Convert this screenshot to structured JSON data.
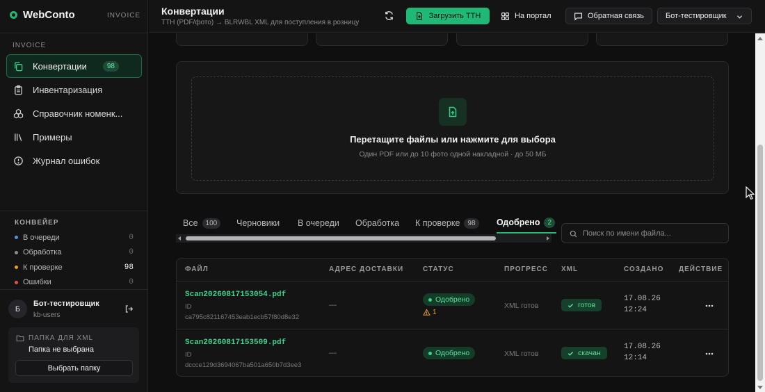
{
  "brand": {
    "name": "WebConto",
    "tag": "INVOICE"
  },
  "sidebar": {
    "section_label": "INVOICE",
    "nav": [
      {
        "label": "Конвертации",
        "badge": "98",
        "icon": "copy-icon",
        "active": true
      },
      {
        "label": "Инвентаризация",
        "icon": "clipboard-icon"
      },
      {
        "label": "Справочник номенк...",
        "icon": "boxes-icon"
      },
      {
        "label": "Примеры",
        "icon": "library-icon"
      },
      {
        "label": "Журнал ошибок",
        "icon": "alert-circle-icon"
      }
    ],
    "pipeline": {
      "label": "КОНВЕЙЕР",
      "items": [
        {
          "label": "В очереди",
          "count": "0",
          "color": "#5a8fd6"
        },
        {
          "label": "Обработка",
          "count": "0",
          "color": "#8c8c8f"
        },
        {
          "label": "К проверке",
          "count": "98",
          "color": "#e5a21f"
        },
        {
          "label": "Ошибки",
          "count": "0",
          "color": "#e0504d"
        }
      ]
    },
    "user": {
      "initial": "Б",
      "name": "Бот-тестировщик",
      "org": "kb-users"
    },
    "folder": {
      "title": "ПАПКА ДЛЯ XML",
      "value": "Папка не выбрана",
      "button": "Выбрать папку"
    }
  },
  "header": {
    "title": "Конвертации",
    "subtitle": "ТТН (PDF/фото) → BLRWBL XML для поступления в розницу",
    "upload_label": "Загрузить ТТН",
    "portal_label": "На портал",
    "feedback_label": "Обратная связь",
    "user_select": "Бот-тестировщик"
  },
  "dropzone": {
    "title": "Перетащите файлы или нажмите для выбора",
    "hint": "Один PDF или до 10 фото одной накладной · до 50 МБ"
  },
  "tabs": [
    {
      "label": "Все",
      "badge": "100"
    },
    {
      "label": "Черновики"
    },
    {
      "label": "В очереди"
    },
    {
      "label": "Обработка"
    },
    {
      "label": "К проверке",
      "badge": "98"
    },
    {
      "label": "Одобрено",
      "badge": "2",
      "active": true
    }
  ],
  "search": {
    "placeholder": "Поиск по имени файла..."
  },
  "table": {
    "columns": [
      "ФАЙЛ",
      "АДРЕС ДОСТАВКИ",
      "СТАТУС",
      "ПРОГРЕСС",
      "XML",
      "СОЗДАНО",
      "ДЕЙСТВИЕ"
    ],
    "rows": [
      {
        "file": "Scan20260817153054.pdf",
        "id_label": "ID",
        "id": "ca795c821167453eab1ecb57f80d8e32",
        "address": "—",
        "status": "Одобрено",
        "warnings": "1",
        "progress": "XML готов",
        "xml": "готов",
        "date": "17.08.26",
        "time": "12:24"
      },
      {
        "file": "Scan20260817153509.pdf",
        "id_label": "ID",
        "id": "dccce129d3694067ba501a650b7d3ee3",
        "address": "—",
        "status": "Одобрено",
        "progress": "XML готов",
        "xml": "скачан",
        "date": "17.08.26",
        "time": "12:14"
      }
    ]
  },
  "colors": {
    "accent": "#1fb877",
    "accent_text": "#3ed38f",
    "warning": "#e5a21f",
    "error": "#e0504d",
    "background": "#0f0f10"
  }
}
